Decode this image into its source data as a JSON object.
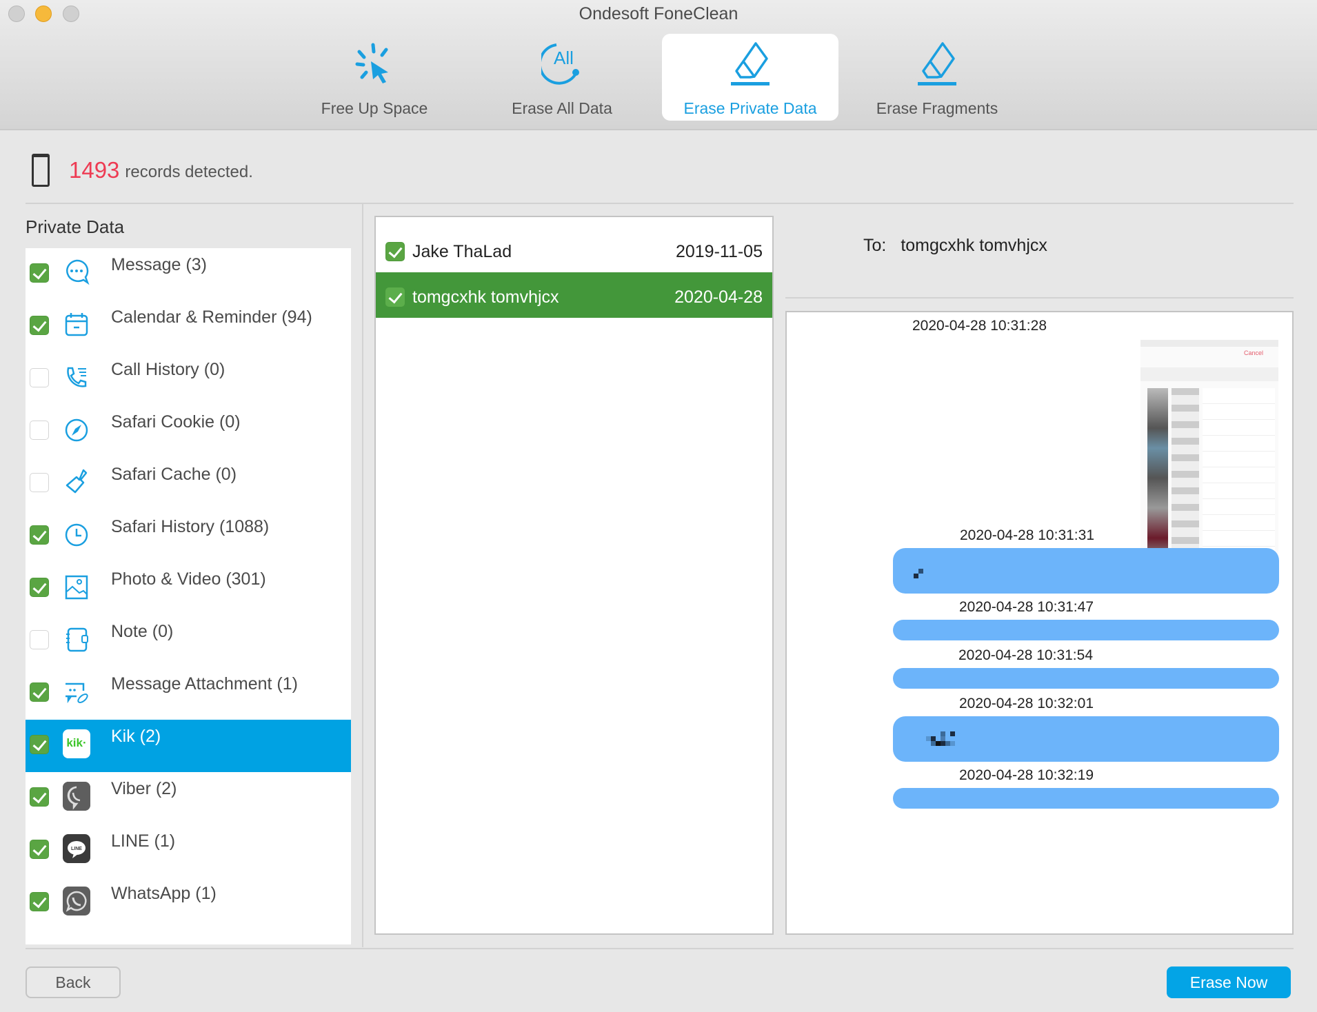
{
  "window": {
    "title": "Ondesoft FoneClean",
    "controls": [
      "close",
      "minimize",
      "zoom"
    ]
  },
  "tabs": [
    {
      "label": "Free Up Space",
      "icon": "cursor-click-icon",
      "active": false
    },
    {
      "label": "Erase All Data",
      "icon": "erase-all-icon",
      "active": false
    },
    {
      "label": "Erase Private Data",
      "icon": "eraser-icon",
      "active": true
    },
    {
      "label": "Erase Fragments",
      "icon": "eraser-icon",
      "active": false
    }
  ],
  "summary": {
    "count": "1493",
    "text": "records detected.",
    "count_color": "#ee3b53"
  },
  "private_data": {
    "title": "Private Data",
    "items": [
      {
        "label": "Message (3)",
        "checked": true,
        "icon": "message-bubble-icon"
      },
      {
        "label": "Calendar & Reminder (94)",
        "checked": true,
        "icon": "calendar-icon"
      },
      {
        "label": "Call History (0)",
        "checked": false,
        "icon": "phone-call-icon"
      },
      {
        "label": "Safari Cookie (0)",
        "checked": false,
        "icon": "compass-icon"
      },
      {
        "label": "Safari Cache (0)",
        "checked": false,
        "icon": "brush-icon"
      },
      {
        "label": "Safari History (1088)",
        "checked": true,
        "icon": "clock-icon"
      },
      {
        "label": "Photo & Video (301)",
        "checked": true,
        "icon": "photo-icon"
      },
      {
        "label": "Note (0)",
        "checked": false,
        "icon": "notebook-icon"
      },
      {
        "label": "Message Attachment (1)",
        "checked": true,
        "icon": "attachment-icon"
      },
      {
        "label": "Kik (2)",
        "checked": true,
        "icon": "kik-icon",
        "selected": true,
        "icon_text": "kik·"
      },
      {
        "label": "Viber (2)",
        "checked": true,
        "icon": "viber-icon"
      },
      {
        "label": "LINE (1)",
        "checked": true,
        "icon": "line-icon",
        "icon_text": "LINE"
      },
      {
        "label": "WhatsApp (1)",
        "checked": true,
        "icon": "whatsapp-icon"
      }
    ]
  },
  "conversations": [
    {
      "name": "Jake ThaLad",
      "date": "2019-11-05",
      "checked": true,
      "selected": false
    },
    {
      "name": "tomgcxhk tomvhjcx",
      "date": "2020-04-28",
      "checked": true,
      "selected": true
    }
  ],
  "detail": {
    "to_label": "To:",
    "to_value": "tomgcxhk tomvhjcx",
    "messages": [
      {
        "time": "2020-04-28 10:31:28",
        "type": "image"
      },
      {
        "time": "2020-04-28 10:31:31",
        "type": "text",
        "content": "[pixelated]"
      },
      {
        "time": "2020-04-28 10:31:47",
        "type": "text",
        "content": ""
      },
      {
        "time": "2020-04-28 10:31:54",
        "type": "text",
        "content": ""
      },
      {
        "time": "2020-04-28 10:32:01",
        "type": "text",
        "content": "[pixelated]"
      },
      {
        "time": "2020-04-28 10:32:19",
        "type": "text",
        "content": ""
      }
    ],
    "bubble_color": "#6cb4fa"
  },
  "footer": {
    "back_label": "Back",
    "erase_label": "Erase Now",
    "erase_color": "#03a4e6"
  },
  "colors": {
    "accent": "#00a2e3",
    "checked": "#5aa543",
    "selected_conversation": "#43973a"
  }
}
